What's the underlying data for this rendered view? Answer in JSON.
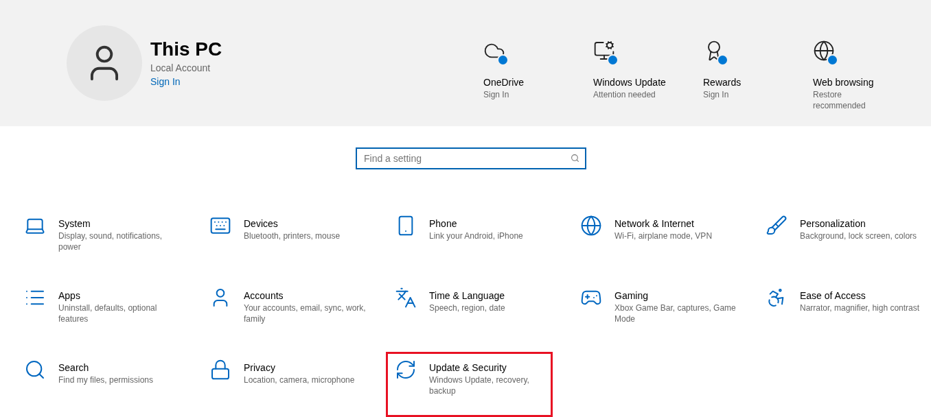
{
  "account": {
    "name": "This PC",
    "type": "Local Account",
    "link": "Sign In"
  },
  "status_items": [
    {
      "kind": "cloud",
      "title": "OneDrive",
      "subtitle": "Sign In"
    },
    {
      "kind": "update",
      "title": "Windows Update",
      "subtitle": "Attention needed"
    },
    {
      "kind": "rewards",
      "title": "Rewards",
      "subtitle": "Sign In"
    },
    {
      "kind": "globe",
      "title": "Web browsing",
      "subtitle": "Restore recommended"
    }
  ],
  "search": {
    "placeholder": "Find a setting"
  },
  "categories": [
    {
      "kind": "laptop",
      "title": "System",
      "description": "Display, sound, notifications, power",
      "highlighted": false
    },
    {
      "kind": "devices",
      "title": "Devices",
      "description": "Bluetooth, printers, mouse",
      "highlighted": false
    },
    {
      "kind": "phone",
      "title": "Phone",
      "description": "Link your Android, iPhone",
      "highlighted": false
    },
    {
      "kind": "globe",
      "title": "Network & Internet",
      "description": "Wi-Fi, airplane mode, VPN",
      "highlighted": false
    },
    {
      "kind": "brush",
      "title": "Personalization",
      "description": "Background, lock screen, colors",
      "highlighted": false
    },
    {
      "kind": "list",
      "title": "Apps",
      "description": "Uninstall, defaults, optional features",
      "highlighted": false
    },
    {
      "kind": "person",
      "title": "Accounts",
      "description": "Your accounts, email, sync, work, family",
      "highlighted": false
    },
    {
      "kind": "language",
      "title": "Time & Language",
      "description": "Speech, region, date",
      "highlighted": false
    },
    {
      "kind": "xbox",
      "title": "Gaming",
      "description": "Xbox Game Bar, captures, Game Mode",
      "highlighted": false
    },
    {
      "kind": "access",
      "title": "Ease of Access",
      "description": "Narrator, magnifier, high contrast",
      "highlighted": false
    },
    {
      "kind": "search",
      "title": "Search",
      "description": "Find my files, permissions",
      "highlighted": false
    },
    {
      "kind": "lock",
      "title": "Privacy",
      "description": "Location, camera, microphone",
      "highlighted": false
    },
    {
      "kind": "sync",
      "title": "Update & Security",
      "description": "Windows Update, recovery, backup",
      "highlighted": true
    }
  ]
}
